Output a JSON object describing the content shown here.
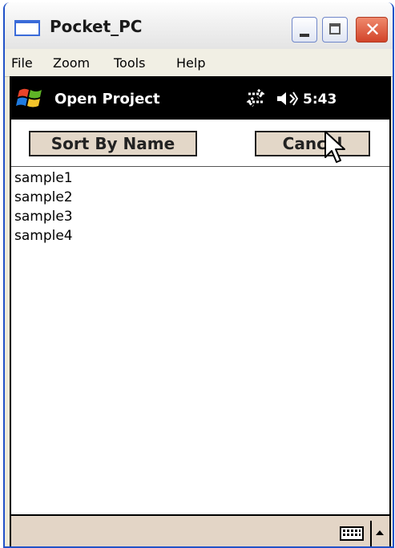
{
  "window": {
    "title": "Pocket_PC",
    "icon": "window-app-icon",
    "controls": {
      "minimize_icon": "minimize-icon",
      "maximize_icon": "maximize-icon",
      "close_label": "✕"
    }
  },
  "menu": {
    "items": [
      {
        "label": "File"
      },
      {
        "label": "Zoom"
      },
      {
        "label": "Tools"
      },
      {
        "label": "Help"
      }
    ]
  },
  "navbar": {
    "title": "Open Project",
    "time": "5:43",
    "icons": [
      "windows-start-icon",
      "connectivity-icon",
      "speaker-icon"
    ]
  },
  "commands": {
    "sort_label": "Sort By Name",
    "cancel_label": "Cancel"
  },
  "files": {
    "items": [
      "sample1",
      "sample2",
      "sample3",
      "sample4"
    ]
  },
  "bottom": {
    "icons": [
      "keyboard-icon",
      "sip-up-arrow-icon"
    ]
  },
  "colors": {
    "nav_background": "#000000",
    "button_background": "#e3d7c8",
    "bottom_bar": "#e3d5c6",
    "window_border": "#2152c8"
  }
}
